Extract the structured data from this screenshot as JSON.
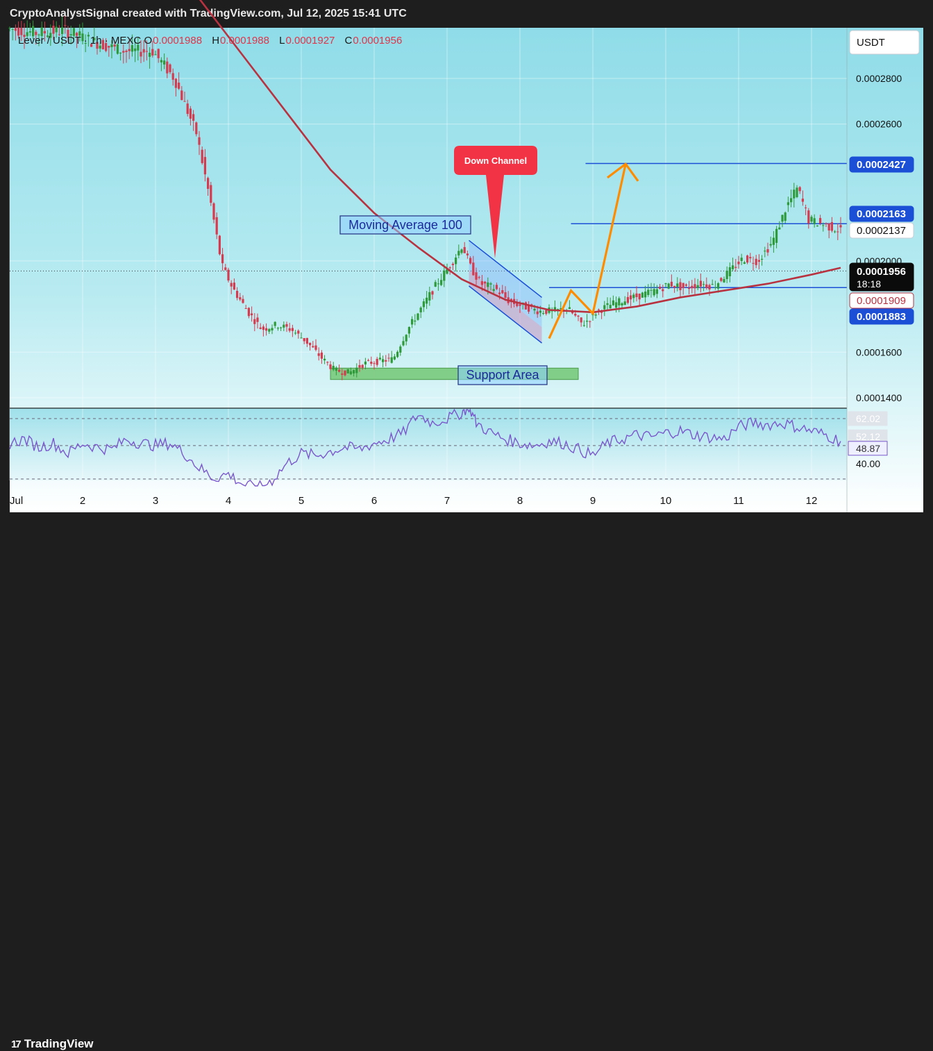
{
  "header": {
    "text": "CryptoAnalystSignal created with TradingView.com, Jul 12, 2025 15:41 UTC"
  },
  "footer": {
    "logo_mark": "17",
    "logo_text": "TradingView"
  },
  "symbol_line": {
    "symbol": "Lever / USDT · 1h · MEXC",
    "o_label": "O",
    "o": "0.0001988",
    "h_label": "H",
    "h": "0.0001988",
    "l_label": "L",
    "l": "0.0001927",
    "c_label": "C",
    "c": "0.0001956"
  },
  "colors": {
    "background_top": "#8fdce8",
    "background_bottom": "#ffffff",
    "bull": "#2e9a3a",
    "bear": "#d63a4e",
    "ma": "#b83240",
    "rsi": "#7a58cc",
    "arrow": "#ff8c00",
    "line_blue": "#1b4fd6"
  },
  "chart_data": {
    "type": "line",
    "title": "Lever / USDT · 1h · MEXC",
    "currency": "USDT",
    "ylim": [
      0.00013,
      0.0003
    ],
    "yticks": [
      "0.0002800",
      "0.0002600",
      "0.0002000",
      "0.0001600",
      "0.0001400"
    ],
    "xticks": [
      "Jul",
      "2",
      "3",
      "4",
      "5",
      "6",
      "7",
      "8",
      "9",
      "10",
      "11",
      "12"
    ],
    "series": [
      {
        "name": "Price",
        "x": [
          1.0,
          1.4,
          1.8,
          2.2,
          2.6,
          3.0,
          3.3,
          3.6,
          3.8,
          3.95,
          4.1,
          4.3,
          4.5,
          4.7,
          4.9,
          5.1,
          5.3,
          5.5,
          5.7,
          5.9,
          6.1,
          6.3,
          6.5,
          6.7,
          6.9,
          7.1,
          7.25,
          7.35,
          7.5,
          7.7,
          7.9,
          8.1,
          8.3,
          8.5,
          8.7,
          8.9,
          9.1,
          9.3,
          9.5,
          9.7,
          9.9,
          10.1,
          10.3,
          10.5,
          10.7,
          10.9,
          11.1,
          11.3,
          11.5,
          11.7,
          11.85,
          12.0,
          12.2,
          12.4
        ],
        "y": [
          0.000302,
          0.0003,
          0.000301,
          0.000296,
          0.000292,
          0.000292,
          0.00028,
          0.000256,
          0.000225,
          0.000198,
          0.000188,
          0.000178,
          0.00017,
          0.000172,
          0.00017,
          0.000165,
          0.000158,
          0.000152,
          0.000151,
          0.000155,
          0.000156,
          0.000157,
          0.00017,
          0.00018,
          0.00019,
          0.000199,
          0.000207,
          0.000198,
          0.00019,
          0.000188,
          0.000182,
          0.00018,
          0.000178,
          0.000178,
          0.000179,
          0.000172,
          0.000178,
          0.000181,
          0.000183,
          0.000185,
          0.000187,
          0.00019,
          0.000188,
          0.00019,
          0.000189,
          0.000195,
          0.000201,
          0.0002,
          0.000208,
          0.000224,
          0.000232,
          0.000218,
          0.000216,
          0.0002137
        ]
      },
      {
        "name": "Moving Average 100",
        "x": [
          1.0,
          2.0,
          3.0,
          3.6,
          4.2,
          4.8,
          5.4,
          6.0,
          6.6,
          7.2,
          7.8,
          8.4,
          9.0,
          9.6,
          10.2,
          10.8,
          11.4,
          12.0,
          12.4
        ],
        "y": [
          0.00034,
          0.00033,
          0.000325,
          0.000315,
          0.00029,
          0.000265,
          0.00024,
          0.000221,
          0.000206,
          0.000192,
          0.000183,
          0.0001785,
          0.0001775,
          0.00018,
          0.000184,
          0.000187,
          0.00019,
          0.000194,
          0.000197
        ]
      }
    ],
    "rsi": {
      "levels": [
        62.02,
        52.12,
        48.87
      ],
      "axis_label": "40.00",
      "x": [
        1.0,
        1.2,
        1.4,
        1.6,
        1.8,
        2.0,
        2.2,
        2.4,
        2.6,
        2.8,
        3.0,
        3.2,
        3.4,
        3.6,
        3.8,
        4.0,
        4.2,
        4.4,
        4.6,
        4.8,
        5.0,
        5.2,
        5.4,
        5.6,
        5.8,
        6.0,
        6.2,
        6.4,
        6.6,
        6.8,
        7.0,
        7.2,
        7.3,
        7.4,
        7.6,
        7.8,
        8.0,
        8.2,
        8.4,
        8.6,
        8.8,
        9.0,
        9.2,
        9.4,
        9.6,
        9.8,
        10.0,
        10.2,
        10.4,
        10.6,
        10.8,
        11.0,
        11.2,
        11.4,
        11.6,
        11.8,
        12.0,
        12.2,
        12.4
      ],
      "y": [
        50,
        52,
        48,
        50,
        45,
        50,
        48,
        47,
        52,
        50,
        49,
        50,
        45,
        38,
        33,
        35,
        30,
        28,
        32,
        40,
        45,
        44,
        46,
        48,
        47,
        50,
        52,
        55,
        64,
        60,
        62,
        65,
        68,
        60,
        55,
        52,
        50,
        49,
        51,
        50,
        47,
        44,
        50,
        52,
        54,
        53,
        55,
        56,
        54,
        53,
        52,
        58,
        60,
        59,
        60,
        58,
        56,
        54,
        51
      ]
    },
    "annotations": {
      "moving_average_label": "Moving Average 100",
      "down_channel_label": "Down Channel",
      "support_label": "Support Area",
      "support_range": [
        0.000148,
        0.000153
      ],
      "hlines": [
        0.0002427,
        0.0002163,
        0.0001883
      ]
    },
    "price_labels": [
      {
        "value": "USDT",
        "style": "white"
      },
      {
        "value": "0.0002427",
        "style": "blue"
      },
      {
        "value": "0.0002163",
        "style": "blue"
      },
      {
        "value": "0.0002137",
        "style": "white"
      },
      {
        "value": "0.0001956",
        "style": "dark",
        "sub": "18:18"
      },
      {
        "value": "0.0001909",
        "style": "red-outline"
      },
      {
        "value": "0.0001883",
        "style": "blue"
      }
    ]
  }
}
